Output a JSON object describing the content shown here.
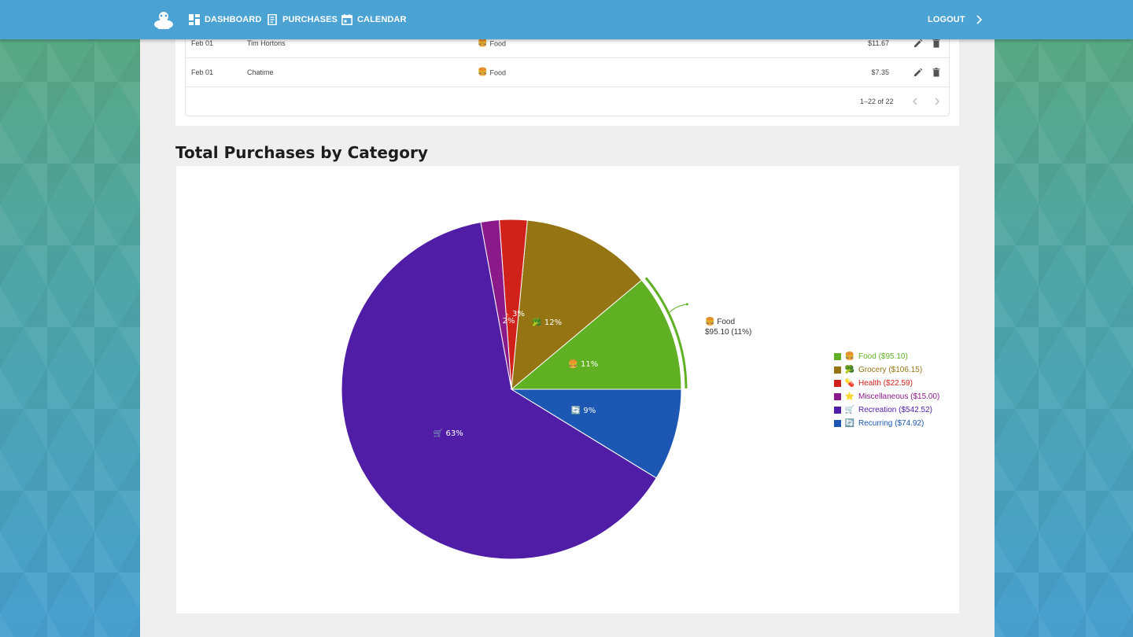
{
  "nav": {
    "items": [
      {
        "label": "DASHBOARD",
        "icon": "dashboard-icon"
      },
      {
        "label": "PURCHASES",
        "icon": "receipt-icon"
      },
      {
        "label": "CALENDAR",
        "icon": "calendar-icon"
      }
    ],
    "logout": "LOGOUT"
  },
  "table": {
    "rows": [
      {
        "date": "Feb 01",
        "name": "Tim Hortons",
        "category": "Food",
        "category_icon": "🍔",
        "amount": "$11.67"
      },
      {
        "date": "Feb 01",
        "name": "Chatime",
        "category": "Food",
        "category_icon": "🍔",
        "amount": "$7.35"
      }
    ],
    "pagination": "1–22 of 22"
  },
  "section_title": "Total Purchases by Category",
  "tooltip": {
    "icon": "🍔",
    "label": "Food",
    "value": "$95.10 (11%)"
  },
  "chart_data": {
    "type": "pie",
    "title": "Total Purchases by Category",
    "categories": [
      "Food",
      "Grocery",
      "Health",
      "Miscellaneous",
      "Recreation",
      "Recurring"
    ],
    "values": [
      95.1,
      106.15,
      22.59,
      15.0,
      542.52,
      74.92
    ],
    "percent_labels": [
      "11%",
      "12%",
      "3%",
      "2%",
      "63%",
      "9%"
    ],
    "legend_labels": [
      "Food ($95.10)",
      "Grocery ($106.15)",
      "Health ($22.59)",
      "Miscellaneous ($15.00)",
      "Recreation ($542.52)",
      "Recurring ($74.92)"
    ],
    "icons": [
      "🍔",
      "🥦",
      "💊",
      "⭐",
      "🛒",
      "🔄"
    ],
    "colors": [
      "#5fb022",
      "#957413",
      "#d0211b",
      "#8a1a8a",
      "#4f1da6",
      "#1c57b3"
    ],
    "legend_position": "right",
    "highlighted": "Food"
  }
}
